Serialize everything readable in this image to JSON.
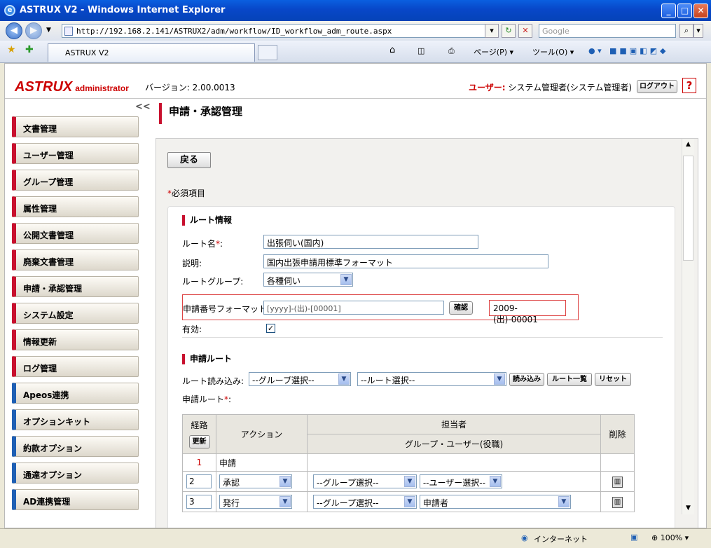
{
  "window": {
    "title": "ASTRUX V2 - Windows Internet Explorer"
  },
  "browser": {
    "url": "http://192.168.2.141/ASTRUX2/adm/workflow/ID_workflow_adm_route.aspx",
    "search_placeholder": "Google",
    "tab_title": "ASTRUX V2",
    "page_menu": "ページ(P)",
    "tools_menu": "ツール(O)"
  },
  "header": {
    "logo": "ASTRUX",
    "logo_sub": "administrator",
    "version": "バージョン: 2.00.0013",
    "user_label": "ユーザー:",
    "user_name": "システム管理者(システム管理者)",
    "logout": "ログアウト",
    "help": "?"
  },
  "sidebar": {
    "collapse": "<<",
    "items": [
      {
        "label": "文書管理"
      },
      {
        "label": "ユーザー管理"
      },
      {
        "label": "グループ管理"
      },
      {
        "label": "属性管理"
      },
      {
        "label": "公開文書管理"
      },
      {
        "label": "廃棄文書管理"
      },
      {
        "label": "申請・承認管理"
      },
      {
        "label": "システム設定"
      },
      {
        "label": "情報更新"
      },
      {
        "label": "ログ管理"
      },
      {
        "label": "Apeos連携"
      },
      {
        "label": "オプションキット"
      },
      {
        "label": "約款オプション"
      },
      {
        "label": "通達オプション"
      },
      {
        "label": "AD連携管理"
      }
    ]
  },
  "main": {
    "title": "申請・承認管理",
    "back": "戻る",
    "required_mark": "*",
    "required_text": "必須項目",
    "route_info": {
      "heading": "ルート情報",
      "name_label": "ルート名",
      "name_value": "出張伺い(国内)",
      "desc_label": "説明:",
      "desc_value": "国内出張申請用標準フォーマット",
      "group_label": "ルートグループ:",
      "group_value": "各種伺い",
      "format_label": "申請番号フォーマット:",
      "format_value": "[yyyy]-(出)-[00001]",
      "confirm_btn": "確認",
      "format_preview": "2009-(出)-00001",
      "enabled_label": "有効:",
      "enabled": true
    },
    "apply_route": {
      "heading": "申請ルート",
      "load_label": "ルート読み込み:",
      "group_select": "--グループ選択--",
      "route_select": "--ルート選択--",
      "load_btn": "読み込み",
      "list_btn": "ルート一覧",
      "reset_btn": "リセット",
      "route_label": "申請ルート",
      "table": {
        "col_route": "経路",
        "update_btn": "更新",
        "col_action": "アクション",
        "col_assignee": "担当者",
        "col_assignee_sub": "グループ・ユーザー(役職)",
        "col_delete": "削除",
        "rows": [
          {
            "num": "1",
            "action": "申請"
          },
          {
            "num": "2",
            "action": "承認",
            "group": "--グループ選択--",
            "user": "--ユーザー選択--"
          },
          {
            "num": "3",
            "action": "発行",
            "group": "--グループ選択--",
            "user": "申請者"
          }
        ]
      }
    }
  },
  "status": {
    "zone": "インターネット",
    "zoom": "100%"
  }
}
